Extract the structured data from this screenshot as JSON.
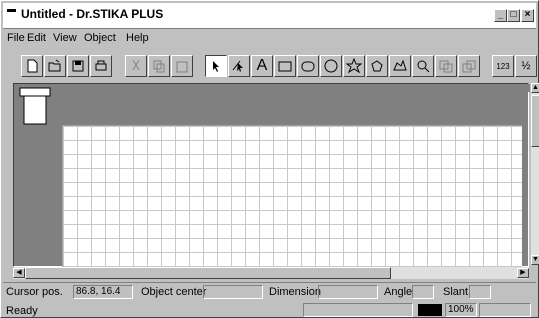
{
  "window": {
    "title": "Untitled - Dr.STIKA PLUS",
    "minimize": "_",
    "restore": "□",
    "close": "×"
  },
  "menu": [
    {
      "label": "File"
    },
    {
      "label": "Edit"
    },
    {
      "label": "View"
    },
    {
      "label": "Object"
    },
    {
      "label": "Help"
    }
  ],
  "toolbar": {
    "text_tool": "A",
    "numbering_label": "123",
    "fraction_label": "½"
  },
  "info": {
    "cursor_label": "Cursor pos.",
    "cursor_value": "86.8, 16.4",
    "center_label": "Object center",
    "center_value": "",
    "dimension_label": "Dimension",
    "dimension_value": "",
    "angle_label": "Angle",
    "angle_value": "",
    "slant_label": "Slant",
    "slant_value": ""
  },
  "status": {
    "text": "Ready",
    "zoom": "100%"
  }
}
